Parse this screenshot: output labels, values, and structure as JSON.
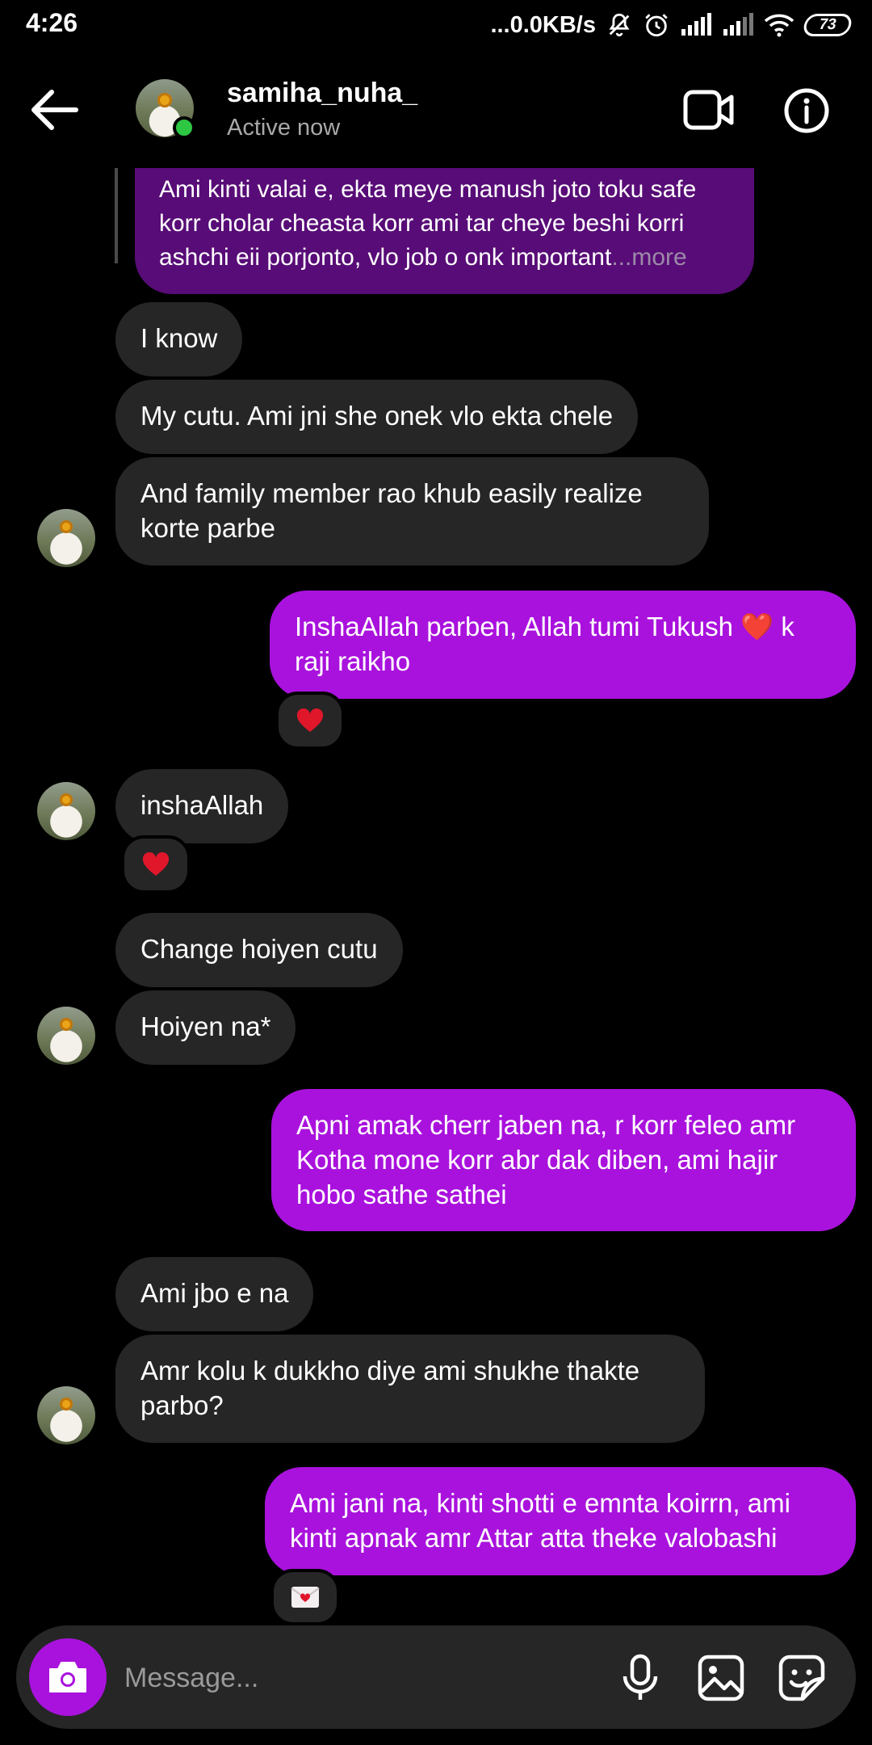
{
  "status_bar": {
    "time": "4:26",
    "network_speed": "...0.0KB/s",
    "battery": "73"
  },
  "header": {
    "username": "samiha_nuha_",
    "status": "Active now"
  },
  "messages": {
    "quote": {
      "text": "Ami kinti valai e, ekta meye manush joto toku safe korr cholar cheasta korr ami tar cheye beshi korri ashchi eii porjonto, vlo job o onk important",
      "more": "...more"
    },
    "m1": "I know",
    "m2": "My cutu. Ami jni she onek vlo ekta chele",
    "m3": "And family member rao khub easily realize korte parbe",
    "m4": "InshaAllah parben, Allah tumi Tukush ❤️ k raji raikho",
    "m5": "inshaAllah",
    "m6": "Change hoiyen cutu",
    "m7": "Hoiyen na*",
    "m8": "Apni amak cherr jaben na, r korr feleo amr Kotha mone korr abr dak diben, ami hajir hobo sathe sathei",
    "m9": "Ami jbo e na",
    "m10": "Amr kolu k dukkho diye ami shukhe thakte parbo?",
    "m11": "Ami jani na, kinti shotti e emnta koirrn, ami kinti apnak amr Attar atta theke valobashi"
  },
  "composer": {
    "placeholder": "Message..."
  },
  "icons": {
    "back": "arrow-left-icon",
    "video": "video-camera-icon",
    "info": "info-icon",
    "camera": "camera-icon",
    "mic": "microphone-icon",
    "gallery": "image-icon",
    "sticker": "sticker-icon"
  },
  "colors": {
    "outgoing_bubble": "#a912dd",
    "incoming_bubble": "#262626",
    "quoted_bubble": "#580c77",
    "online_dot": "#2ec744",
    "heart": "#e0162b"
  }
}
